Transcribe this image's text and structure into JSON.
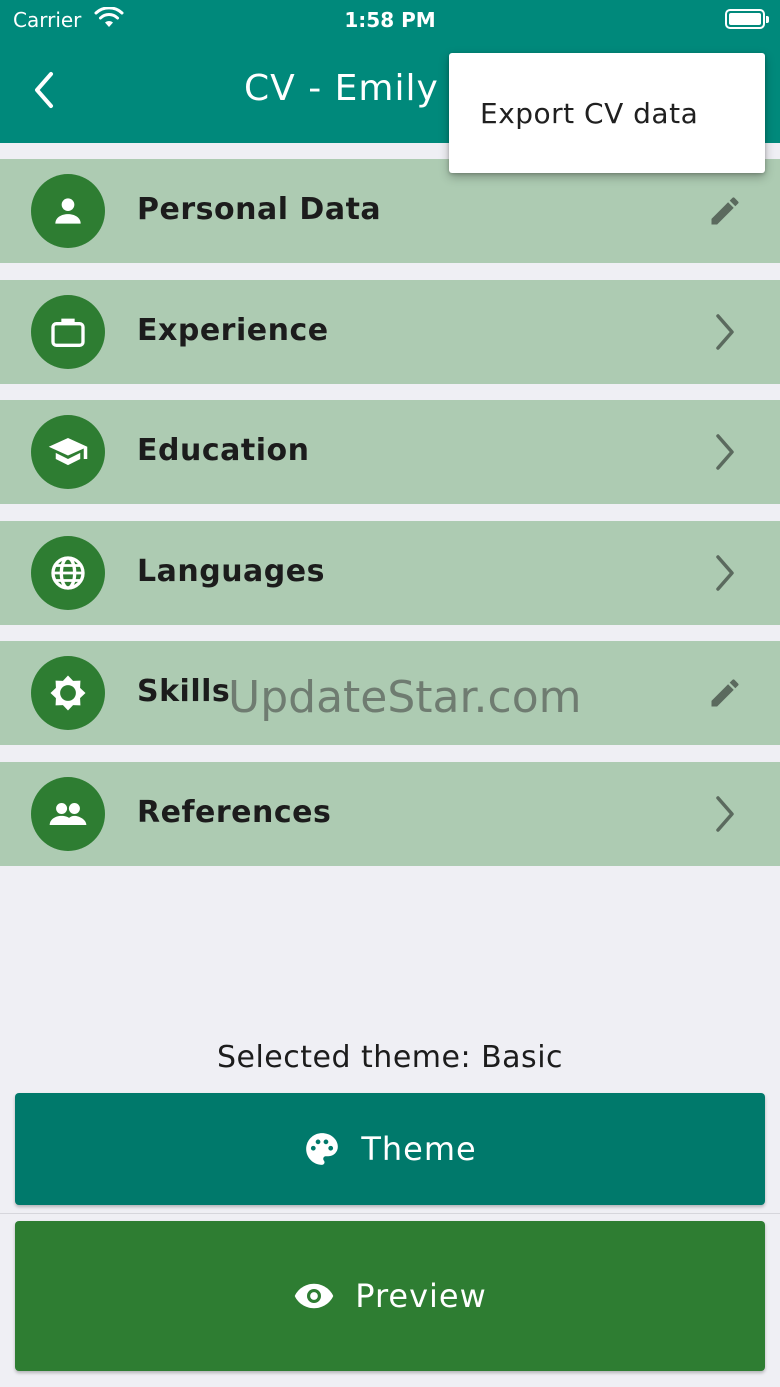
{
  "status_bar": {
    "carrier": "Carrier",
    "time": "1:58 PM"
  },
  "app_bar": {
    "title": "CV - Emily I"
  },
  "menu": {
    "items": [
      {
        "label": "Export CV data"
      }
    ]
  },
  "sections": [
    {
      "label": "Personal Data",
      "icon": "person-icon",
      "action_icon": "pencil-icon"
    },
    {
      "label": "Experience",
      "icon": "briefcase-icon",
      "action_icon": "chevron-right-icon"
    },
    {
      "label": "Education",
      "icon": "graduation-cap-icon",
      "action_icon": "chevron-right-icon"
    },
    {
      "label": "Languages",
      "icon": "globe-icon",
      "action_icon": "chevron-right-icon"
    },
    {
      "label": "Skills",
      "icon": "brightness-icon",
      "action_icon": "pencil-icon"
    },
    {
      "label": "References",
      "icon": "people-icon",
      "action_icon": "chevron-right-icon"
    }
  ],
  "watermark": "UpdateStar.com",
  "theme_caption": "Selected theme: Basic",
  "buttons": {
    "theme_label": "Theme",
    "preview_label": "Preview"
  },
  "colors": {
    "app_bar": "#00897b",
    "row_background": "#adcbb2",
    "avatar": "#2e7d32",
    "theme_button": "#00796b",
    "preview_button": "#2e7d32",
    "background": "#efeff4"
  }
}
